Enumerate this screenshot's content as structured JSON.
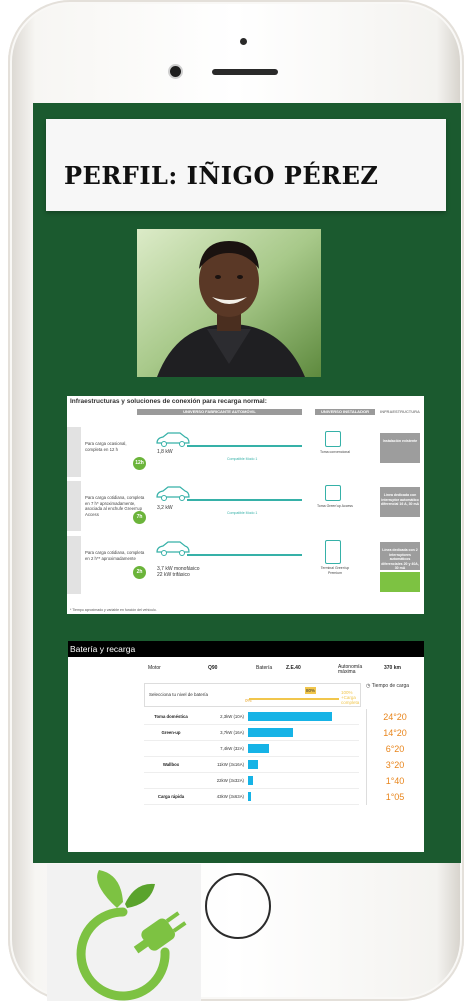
{
  "profile": {
    "title": "PERFIL:  IÑIGO PÉREZ"
  },
  "infographic": {
    "title": "Infraestructuras y soluciones de conexión para recarga normal:",
    "col_car": "UNIVERSO FABRICANTE AUTOMÓVIL",
    "col_inst": "UNIVERSO INSTALADOR",
    "col_infra": "INFRAESTRUCTURA",
    "rows": [
      {
        "desc": "Para carga ocasional, completa en 12 h",
        "hours": "12h",
        "kw": "1,8 kW",
        "modo": "Compatible Modo 1",
        "socket": "Toma convencional",
        "infra": "Instalación existente"
      },
      {
        "desc": "Para carga cotidiana, completa en 7 h* aproximadamente, asociada al enchufe Green'up Access",
        "hours": "7h",
        "kw": "3,2 kW",
        "modo": "Compatible Modo 1",
        "socket": "Toma Green'up Access",
        "infra": "Línea dedicada con interruptor automático diferencial 16 A, 30 mA"
      },
      {
        "desc": "Para carga cotidiana, completa en 2 h** aproximadamente",
        "hours": "2h",
        "kw": "3,7 kW monofásico\n22 kW trifásico",
        "modo": "",
        "socket": "Terminal Green'up Premium",
        "infra": "Línea dedicada con 2 interruptores automáticos diferenciales 20 y 40A, 30 mA"
      }
    ],
    "footnote": "* Tiempo aproximado y variable en función del vehículo."
  },
  "battery": {
    "header": "Batería y recarga",
    "motor_label": "Motor",
    "motor_value": "Q90",
    "bateria_label": "Batería",
    "bateria_value": "Z.E.40",
    "autonomia_label": "Autonomía máxima",
    "autonomia_value": "370 km",
    "select_label": "Selecciona tu nivel de batería",
    "pct_start": "0%",
    "pct_marker": "80%",
    "pct_end": "100% +Carga completa",
    "tiempo_label": "Tiempo de carga",
    "rows": [
      {
        "label": "Toma doméstica",
        "power": "2,3kW (10A)",
        "fill": 0.78,
        "time": "24°20"
      },
      {
        "label": "Green-up",
        "power": "3,7kW (16A)",
        "fill": 0.42,
        "time": "14°20"
      },
      {
        "label": "",
        "power": "7,4kW (32A)",
        "fill": 0.19,
        "time": "6°20"
      },
      {
        "label": "Wallbox",
        "power": "11kW (3x16A)",
        "fill": 0.09,
        "time": "3°20"
      },
      {
        "label": "",
        "power": "22kW (3x32A)",
        "fill": 0.05,
        "time": "1°40"
      },
      {
        "label": "Carga rápida",
        "power": "43kW (3x63A)",
        "fill": 0.03,
        "time": "1°05"
      }
    ]
  },
  "colors": {
    "screen_green": "#1b5a2f",
    "bar_blue": "#16b3e6",
    "time_orange": "#e8851c",
    "logo_green": "#7dc242"
  }
}
